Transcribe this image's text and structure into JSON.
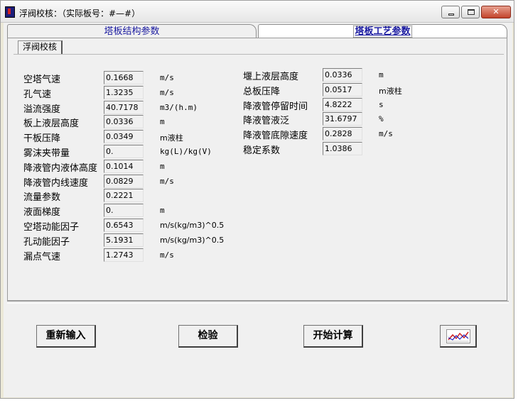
{
  "window": {
    "title": "浮阀校核：（实际板号：#—#）"
  },
  "tabs": [
    {
      "label": "塔板结构参数",
      "active": false
    },
    {
      "label": "塔板工艺参数",
      "active": true
    }
  ],
  "subtab": {
    "label": "浮阀校核"
  },
  "left_params": [
    {
      "label": "空塔气速",
      "value": "0.1668",
      "unit": "m/s"
    },
    {
      "label": "孔气速",
      "value": "1.3235",
      "unit": "m/s"
    },
    {
      "label": "溢流强度",
      "value": "40.7178",
      "unit": "m3/(h.m)"
    },
    {
      "label": "板上液层高度",
      "value": "0.0336",
      "unit": "m"
    },
    {
      "label": "干板压降",
      "value": "0.0349",
      "unit": "m液柱"
    },
    {
      "label": "雾沫夹带量",
      "value": "0.",
      "unit": "kg(L)/kg(V)"
    },
    {
      "label": "降液管内液体高度",
      "value": "0.1014",
      "unit": "m"
    },
    {
      "label": "降液管内线速度",
      "value": "0.0829",
      "unit": "m/s"
    },
    {
      "label": "流量参数",
      "value": "0.2221",
      "unit": ""
    },
    {
      "label": "液面梯度",
      "value": "0.",
      "unit": "m"
    },
    {
      "label": "空塔动能因子",
      "value": "0.6543",
      "unit": "m/s(kg/m3)^0.5"
    },
    {
      "label": "孔动能因子",
      "value": "5.1931",
      "unit": "m/s(kg/m3)^0.5"
    },
    {
      "label": "漏点气速",
      "value": "1.2743",
      "unit": "m/s"
    }
  ],
  "right_params": [
    {
      "label": "堰上液层高度",
      "value": "0.0336",
      "unit": "m"
    },
    {
      "label": "总板压降",
      "value": "0.0517",
      "unit": "m液柱"
    },
    {
      "label": "降液管停留时间",
      "value": "4.8222",
      "unit": "s"
    },
    {
      "label": "降液管液泛",
      "value": "31.6797",
      "unit": "%"
    },
    {
      "label": "降液管底隙速度",
      "value": "0.2828",
      "unit": "m/s"
    },
    {
      "label": "稳定系数",
      "value": "1.0386",
      "unit": ""
    }
  ],
  "buttons": {
    "reinput": "重新输入",
    "check": "检验",
    "calculate": "开始计算",
    "chart_icon": "line-chart-icon"
  },
  "colors": {
    "tab_text": "#1a1aa0",
    "chart_line_red": "#d02020",
    "chart_line_blue": "#2020c0"
  }
}
